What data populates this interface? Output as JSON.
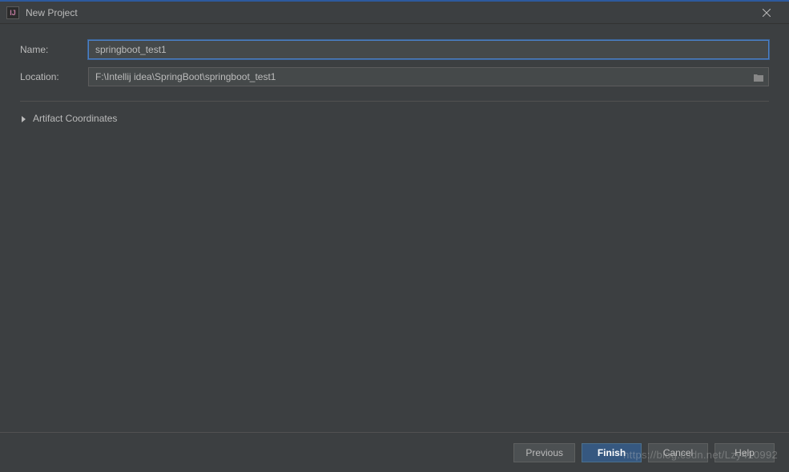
{
  "titlebar": {
    "app_icon_text": "IJ",
    "title": "New Project"
  },
  "form": {
    "name_label": "Name:",
    "name_value": "springboot_test1",
    "location_label": "Location:",
    "location_value": "F:\\Intellij idea\\SpringBoot\\springboot_test1"
  },
  "expandable": {
    "artifact_label": "Artifact Coordinates"
  },
  "footer": {
    "previous": "Previous",
    "finish": "Finish",
    "cancel": "Cancel",
    "help": "Help"
  },
  "watermark": "https://blog.csdn.net/Lzy410992"
}
